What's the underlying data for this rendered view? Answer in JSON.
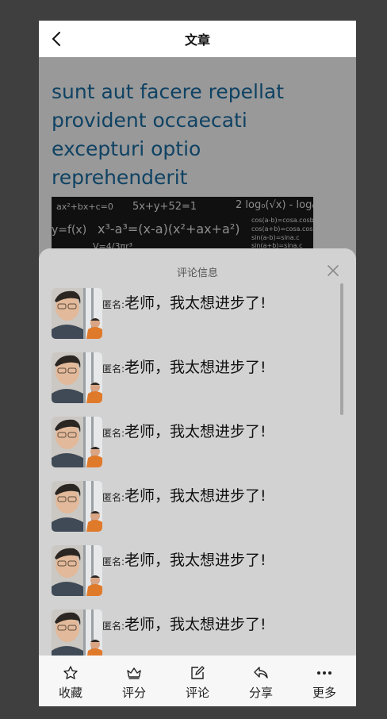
{
  "header": {
    "title": "文章",
    "back_icon": "chevron-left-icon"
  },
  "article": {
    "title": "sunt aut facere repellat provident occaecati excepturi optio reprehenderit",
    "image_formulas": [
      "ax²+bx+c=0",
      "5x+y+52=1",
      "2 log₀(√x) - log₀",
      "y=f(x)",
      "x³-a³=(x-a)(x²+ax+a²)",
      "cos(a-b)=cosa.cosb",
      "cos(a+b)=cosa.cosb",
      "sin(a-b)=sina.c",
      "sin(a+b)=sina.c",
      "V=4/3πr³"
    ]
  },
  "sheet": {
    "title": "评论信息",
    "comments": [
      {
        "user": "匿名:",
        "text": "老师，我太想进步了!"
      },
      {
        "user": "匿名:",
        "text": "老师，我太想进步了!"
      },
      {
        "user": "匿名:",
        "text": "老师，我太想进步了!"
      },
      {
        "user": "匿名:",
        "text": "老师，我太想进步了!"
      },
      {
        "user": "匿名:",
        "text": "老师，我太想进步了!"
      },
      {
        "user": "匿名:",
        "text": "老师，我太想进步了!"
      }
    ]
  },
  "toolbar": {
    "items": [
      {
        "label": "收藏",
        "icon": "star-icon"
      },
      {
        "label": "评分",
        "icon": "crown-icon"
      },
      {
        "label": "评论",
        "icon": "edit-icon"
      },
      {
        "label": "分享",
        "icon": "share-icon"
      },
      {
        "label": "更多",
        "icon": "more-icon"
      }
    ]
  },
  "colors": {
    "page_bg": "#3f3f3f",
    "title_blue": "#1a6ea6",
    "sheet_bg": "#d2d2d2",
    "toolbar_bg": "#f7f7f7"
  }
}
